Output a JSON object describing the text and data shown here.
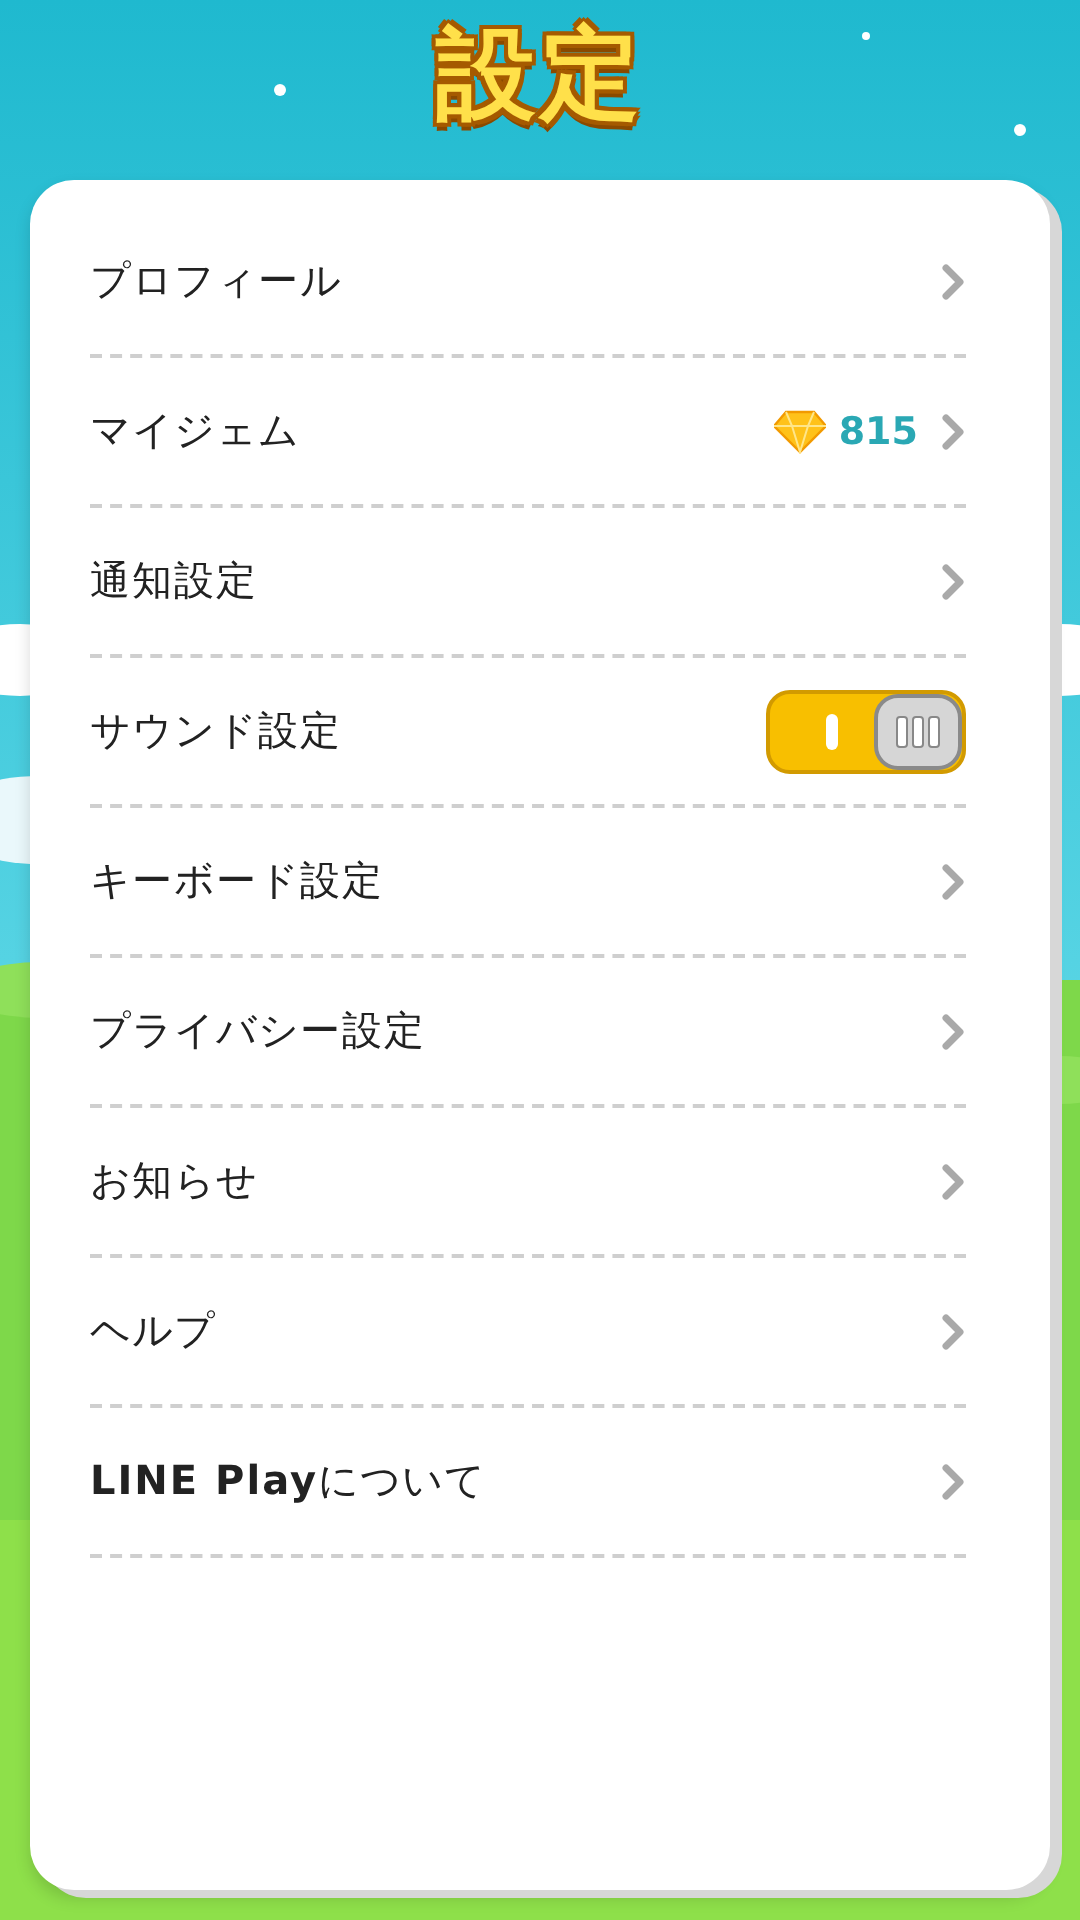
{
  "title": "設定",
  "items": [
    {
      "kind": "link",
      "label": "プロフィール"
    },
    {
      "kind": "gem",
      "label": "マイジェム",
      "count": "815"
    },
    {
      "kind": "link",
      "label": "通知設定"
    },
    {
      "kind": "toggle",
      "label": "サウンド設定",
      "on": true
    },
    {
      "kind": "link",
      "label": "キーボード設定"
    },
    {
      "kind": "link",
      "label": "プライバシー設定"
    },
    {
      "kind": "link",
      "label": "お知らせ"
    },
    {
      "kind": "link",
      "label": "ヘルプ"
    },
    {
      "kind": "link",
      "label": "**LINE Play**について"
    }
  ]
}
